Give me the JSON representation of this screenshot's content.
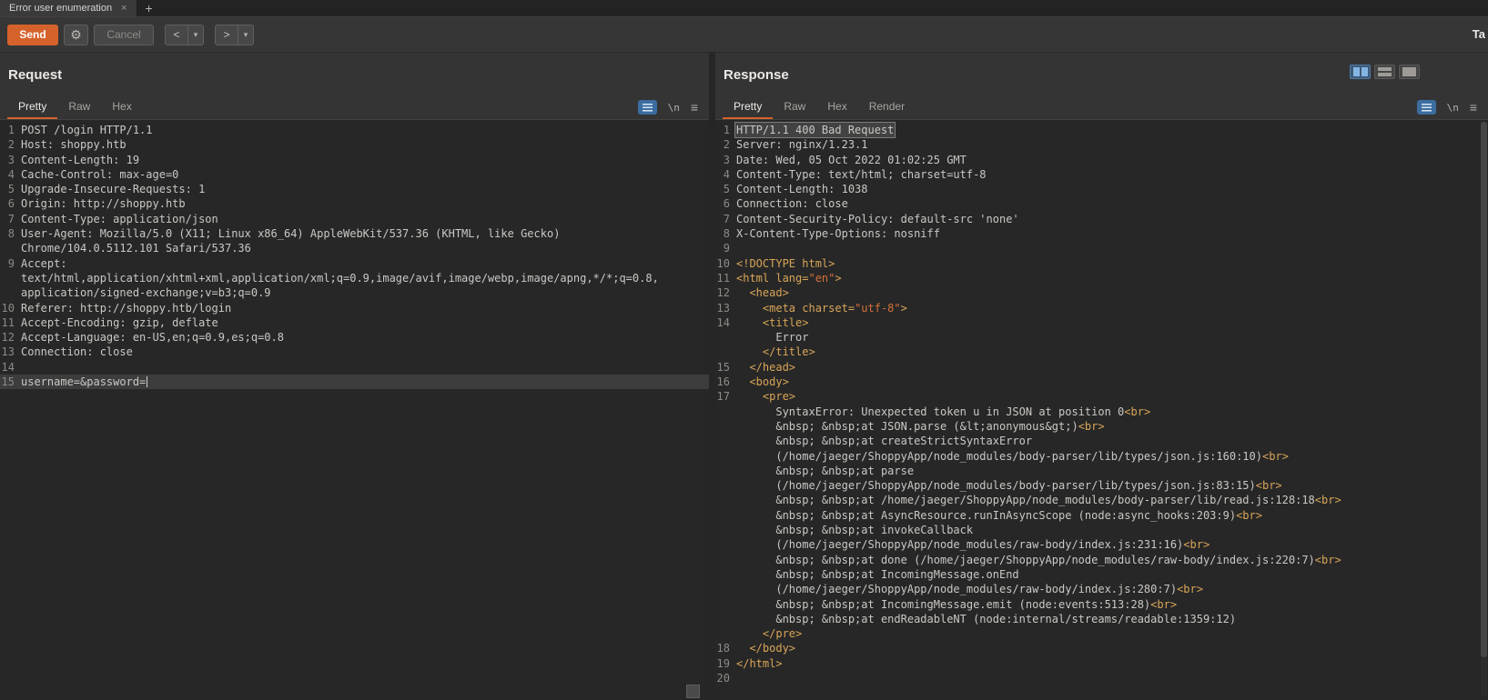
{
  "window": {
    "tab_title": "Error user enumeration",
    "close_tab": "×",
    "new_tab": "+",
    "target_label_truncated": "Ta"
  },
  "toolbar": {
    "send": "Send",
    "cancel": "Cancel",
    "back": "<",
    "forward": ">",
    "dropdown_arrow": "▾",
    "gear_icon": "⚙"
  },
  "editor_bar": {
    "newline_label": "\\n",
    "menu_icon": "≡"
  },
  "colors": {
    "accent_orange": "#d6622b",
    "editor_background": "#272727",
    "html_tag": "#d8a558",
    "html_string": "#d4703a",
    "plain_text": "#cbc8c4"
  },
  "request_panel": {
    "title": "Request",
    "tabs": [
      "Pretty",
      "Raw",
      "Hex"
    ],
    "active_tab": "Pretty",
    "rows": [
      {
        "n": "1",
        "s": [
          [
            "POST /login HTTP/1.1",
            "p"
          ]
        ]
      },
      {
        "n": "2",
        "s": [
          [
            "Host: shoppy.htb",
            "p"
          ]
        ]
      },
      {
        "n": "3",
        "s": [
          [
            "Content-Length: 19",
            "p"
          ]
        ]
      },
      {
        "n": "4",
        "s": [
          [
            "Cache-Control: max-age=0",
            "p"
          ]
        ]
      },
      {
        "n": "5",
        "s": [
          [
            "Upgrade-Insecure-Requests: 1",
            "p"
          ]
        ]
      },
      {
        "n": "6",
        "s": [
          [
            "Origin: http://shoppy.htb",
            "p"
          ]
        ]
      },
      {
        "n": "7",
        "s": [
          [
            "Content-Type: application/json",
            "p"
          ]
        ]
      },
      {
        "n": "8",
        "s": [
          [
            "User-Agent: Mozilla/5.0 (X11; Linux x86_64) AppleWebKit/537.36 (KHTML, like Gecko)",
            "p"
          ]
        ]
      },
      {
        "n": "",
        "s": [
          [
            "Chrome/104.0.5112.101 Safari/537.36",
            "p"
          ]
        ]
      },
      {
        "n": "9",
        "s": [
          [
            "Accept:",
            "p"
          ]
        ]
      },
      {
        "n": "",
        "s": [
          [
            "text/html,application/xhtml+xml,application/xml;q=0.9,image/avif,image/webp,image/apng,*/*;q=0.8,",
            "p"
          ]
        ]
      },
      {
        "n": "",
        "s": [
          [
            "application/signed-exchange;v=b3;q=0.9",
            "p"
          ]
        ]
      },
      {
        "n": "10",
        "s": [
          [
            "Referer: http://shoppy.htb/login",
            "p"
          ]
        ]
      },
      {
        "n": "11",
        "s": [
          [
            "Accept-Encoding: gzip, deflate",
            "p"
          ]
        ]
      },
      {
        "n": "12",
        "s": [
          [
            "Accept-Language: en-US,en;q=0.9,es;q=0.8",
            "p"
          ]
        ]
      },
      {
        "n": "13",
        "s": [
          [
            "Connection: close",
            "p"
          ]
        ]
      },
      {
        "n": "14",
        "s": []
      },
      {
        "n": "15",
        "hl": "caret",
        "s": [
          [
            "username=&password=",
            "p"
          ]
        ]
      }
    ]
  },
  "response_panel": {
    "title": "Response",
    "tabs": [
      "Pretty",
      "Raw",
      "Hex",
      "Render"
    ],
    "active_tab": "Pretty",
    "rows": [
      {
        "n": "1",
        "hl": "sel",
        "s": [
          [
            "HTTP/1.1 400 Bad Request",
            "p"
          ]
        ]
      },
      {
        "n": "2",
        "s": [
          [
            "Server: nginx/1.23.1",
            "p"
          ]
        ]
      },
      {
        "n": "3",
        "s": [
          [
            "Date: Wed, 05 Oct 2022 01:02:25 GMT",
            "p"
          ]
        ]
      },
      {
        "n": "4",
        "s": [
          [
            "Content-Type: text/html; charset=utf-8",
            "p"
          ]
        ]
      },
      {
        "n": "5",
        "s": [
          [
            "Content-Length: 1038",
            "p"
          ]
        ]
      },
      {
        "n": "6",
        "s": [
          [
            "Connection: close",
            "p"
          ]
        ]
      },
      {
        "n": "7",
        "s": [
          [
            "Content-Security-Policy: default-src 'none'",
            "p"
          ]
        ]
      },
      {
        "n": "8",
        "s": [
          [
            "X-Content-Type-Options: nosniff",
            "p"
          ]
        ]
      },
      {
        "n": "9",
        "s": []
      },
      {
        "n": "10",
        "s": [
          [
            "<!DOCTYPE html>",
            "t"
          ]
        ]
      },
      {
        "n": "11",
        "s": [
          [
            "<html lang=",
            "t"
          ],
          [
            "\"en\"",
            "s"
          ],
          [
            ">",
            "t"
          ]
        ]
      },
      {
        "n": "12",
        "s": [
          [
            "  ",
            "p"
          ],
          [
            "<head>",
            "t"
          ]
        ]
      },
      {
        "n": "13",
        "s": [
          [
            "    ",
            "p"
          ],
          [
            "<meta charset=",
            "t"
          ],
          [
            "\"utf-8\"",
            "s"
          ],
          [
            ">",
            "t"
          ]
        ]
      },
      {
        "n": "14",
        "s": [
          [
            "    ",
            "p"
          ],
          [
            "<title>",
            "t"
          ]
        ]
      },
      {
        "n": "",
        "s": [
          [
            "      Error",
            "p"
          ]
        ]
      },
      {
        "n": "",
        "s": [
          [
            "    ",
            "p"
          ],
          [
            "</title>",
            "t"
          ]
        ]
      },
      {
        "n": "15",
        "s": [
          [
            "  ",
            "p"
          ],
          [
            "</head>",
            "t"
          ]
        ]
      },
      {
        "n": "16",
        "s": [
          [
            "  ",
            "p"
          ],
          [
            "<body>",
            "t"
          ]
        ]
      },
      {
        "n": "17",
        "s": [
          [
            "    ",
            "p"
          ],
          [
            "<pre>",
            "t"
          ]
        ]
      },
      {
        "n": "",
        "s": [
          [
            "      SyntaxError: Unexpected token u in JSON at position 0",
            "p"
          ],
          [
            "<br>",
            "t"
          ]
        ]
      },
      {
        "n": "",
        "s": [
          [
            "      &nbsp; &nbsp;at JSON.parse (&lt;anonymous&gt;)",
            "p"
          ],
          [
            "<br>",
            "t"
          ]
        ]
      },
      {
        "n": "",
        "s": [
          [
            "      &nbsp; &nbsp;at createStrictSyntaxError",
            "p"
          ]
        ]
      },
      {
        "n": "",
        "s": [
          [
            "      (/home/jaeger/ShoppyApp/node_modules/body-parser/lib/types/json.js:160:10)",
            "p"
          ],
          [
            "<br>",
            "t"
          ]
        ]
      },
      {
        "n": "",
        "s": [
          [
            "      &nbsp; &nbsp;at parse",
            "p"
          ]
        ]
      },
      {
        "n": "",
        "s": [
          [
            "      (/home/jaeger/ShoppyApp/node_modules/body-parser/lib/types/json.js:83:15)",
            "p"
          ],
          [
            "<br>",
            "t"
          ]
        ]
      },
      {
        "n": "",
        "s": [
          [
            "      &nbsp; &nbsp;at /home/jaeger/ShoppyApp/node_modules/body-parser/lib/read.js:128:18",
            "p"
          ],
          [
            "<br>",
            "t"
          ]
        ]
      },
      {
        "n": "",
        "s": [
          [
            "      &nbsp; &nbsp;at AsyncResource.runInAsyncScope (node:async_hooks:203:9)",
            "p"
          ],
          [
            "<br>",
            "t"
          ]
        ]
      },
      {
        "n": "",
        "s": [
          [
            "      &nbsp; &nbsp;at invokeCallback",
            "p"
          ]
        ]
      },
      {
        "n": "",
        "s": [
          [
            "      (/home/jaeger/ShoppyApp/node_modules/raw-body/index.js:231:16)",
            "p"
          ],
          [
            "<br>",
            "t"
          ]
        ]
      },
      {
        "n": "",
        "s": [
          [
            "      &nbsp; &nbsp;at done (/home/jaeger/ShoppyApp/node_modules/raw-body/index.js:220:7)",
            "p"
          ],
          [
            "<br>",
            "t"
          ]
        ]
      },
      {
        "n": "",
        "s": [
          [
            "      &nbsp; &nbsp;at IncomingMessage.onEnd",
            "p"
          ]
        ]
      },
      {
        "n": "",
        "s": [
          [
            "      (/home/jaeger/ShoppyApp/node_modules/raw-body/index.js:280:7)",
            "p"
          ],
          [
            "<br>",
            "t"
          ]
        ]
      },
      {
        "n": "",
        "s": [
          [
            "      &nbsp; &nbsp;at IncomingMessage.emit (node:events:513:28)",
            "p"
          ],
          [
            "<br>",
            "t"
          ]
        ]
      },
      {
        "n": "",
        "s": [
          [
            "      &nbsp; &nbsp;at endReadableNT (node:internal/streams/readable:1359:12)",
            "p"
          ]
        ]
      },
      {
        "n": "",
        "s": [
          [
            "    ",
            "p"
          ],
          [
            "</pre>",
            "t"
          ]
        ]
      },
      {
        "n": "18",
        "s": [
          [
            "  ",
            "p"
          ],
          [
            "</body>",
            "t"
          ]
        ]
      },
      {
        "n": "19",
        "s": [
          [
            "</html>",
            "t"
          ]
        ]
      },
      {
        "n": "20",
        "s": []
      }
    ]
  }
}
